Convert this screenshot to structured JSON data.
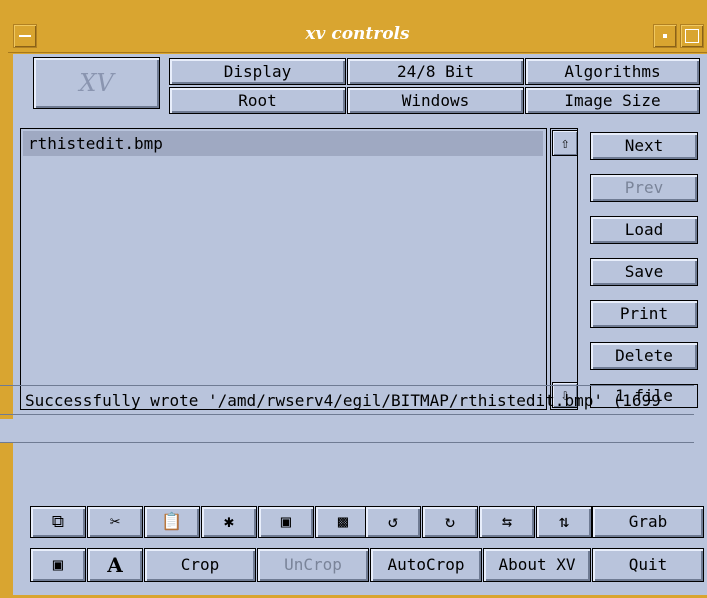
{
  "window": {
    "title": "xv controls"
  },
  "logo": {
    "text": "XV"
  },
  "menu": {
    "display": "Display",
    "bit": "24/8 Bit",
    "algorithms": "Algorithms",
    "root": "Root",
    "windows": "Windows",
    "image_size": "Image Size"
  },
  "file_list": {
    "items": [
      "rthistedit.bmp"
    ]
  },
  "side_buttons": {
    "next": "Next",
    "prev": "Prev",
    "load": "Load",
    "save": "Save",
    "print": "Print",
    "delete": "Delete",
    "file_count": "1 file"
  },
  "status": {
    "message": "Successfully wrote '/amd/rwserv4/egil/BITMAP/rthistedit.bmp' (1699"
  },
  "toolbar": {
    "grab": "Grab",
    "crop": "Crop",
    "uncrop": "UnCrop",
    "autocrop": "AutoCrop",
    "about": "About XV",
    "quit": "Quit",
    "icons": [
      "copy-icon",
      "cut-icon",
      "paste-icon",
      "clear-icon",
      "pad-icon",
      "fit-icon",
      "rotate-left-icon",
      "rotate-right-icon",
      "flip-horizontal-icon",
      "flip-vertical-icon",
      "text-annotate-icon",
      "font-icon"
    ]
  }
}
